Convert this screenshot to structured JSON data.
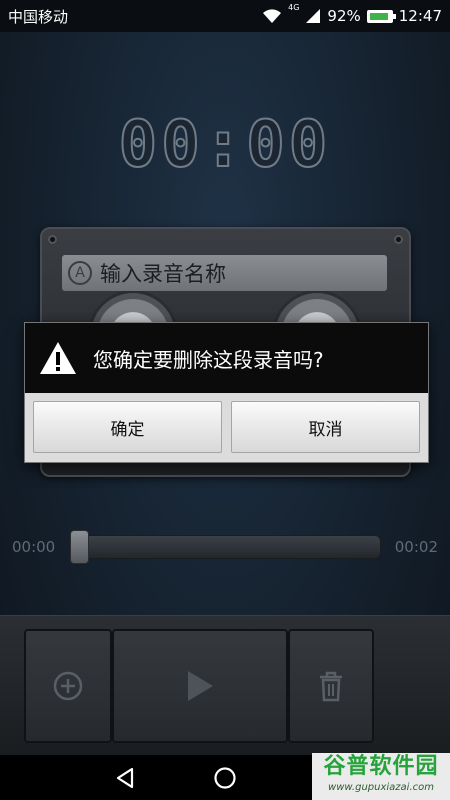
{
  "status": {
    "carrier": "中国移动",
    "network": "4G",
    "battery_percent": "92%",
    "battery_level": 0.92,
    "time": "12:47"
  },
  "timer": "00:00",
  "recording": {
    "name_placeholder": "输入录音名称",
    "input_icon_letter": "A"
  },
  "dialog": {
    "message": "您确定要删除这段录音吗?",
    "confirm_label": "确定",
    "cancel_label": "取消",
    "icon": "warning-icon"
  },
  "player": {
    "elapsed": "00:00",
    "duration": "00:02",
    "progress": 0.0
  },
  "controls": {
    "add_icon": "plus-circle-icon",
    "play_icon": "play-icon",
    "delete_icon": "trash-icon"
  },
  "watermark": {
    "title": "谷普软件园",
    "url": "www.gupuxiazai.com"
  },
  "colors": {
    "battery_green": "#3fb24a",
    "watermark_green": "#27a33b"
  }
}
